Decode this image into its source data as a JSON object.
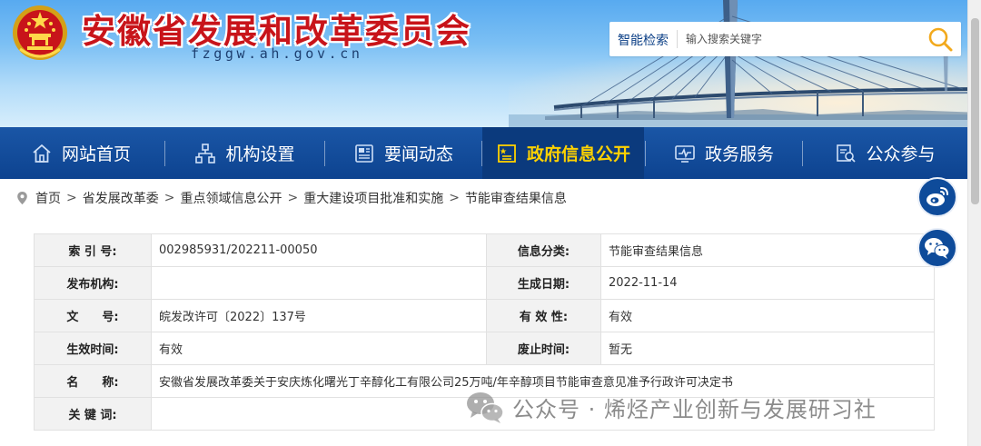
{
  "header": {
    "site_title": "安徽省发展和改革委员会",
    "site_domain": "fzggw.ah.gov.cn",
    "emblem_icon": "national-emblem-icon"
  },
  "search": {
    "label": "智能检索",
    "placeholder": "输入搜索关键字",
    "button_icon": "search-icon"
  },
  "nav": {
    "items": [
      {
        "label": "网站首页",
        "icon": "home-icon"
      },
      {
        "label": "机构设置",
        "icon": "org-chart-icon"
      },
      {
        "label": "要闻动态",
        "icon": "news-icon"
      },
      {
        "label": "政府信息公开",
        "icon": "info-disclosure-icon"
      },
      {
        "label": "政务服务",
        "icon": "service-icon"
      },
      {
        "label": "公众参与",
        "icon": "participation-icon"
      }
    ],
    "active_index": 3
  },
  "breadcrumb": {
    "icon": "location-pin-icon",
    "separator": ">",
    "items": [
      "首页",
      "省发展改革委",
      "重点领域信息公开",
      "重大建设项目批准和实施",
      "节能审查结果信息"
    ]
  },
  "info": {
    "index_label": "索 引 号:",
    "index_value": "002985931/202211-00050",
    "category_label": "信息分类:",
    "category_value": "节能审查结果信息",
    "publisher_label": "发布机构:",
    "publisher_value": "",
    "date_label": "生成日期:",
    "date_value": "2022-11-14",
    "doc_label": "文　　号:",
    "doc_value": "皖发改许可〔2022〕137号",
    "validity_label": "有 效 性:",
    "validity_value": "有效",
    "effective_label": "生效时间:",
    "effective_value": "有效",
    "repeal_label": "废止时间:",
    "repeal_value": "暂无",
    "name_label": "名　　称:",
    "name_value": "安徽省发展改革委关于安庆炼化曙光丁辛醇化工有限公司25万吨/年辛醇项目节能审查意见准予行政许可决定书",
    "keywords_label": "关 键 词:",
    "keywords_value": ""
  },
  "side": {
    "weibo_icon": "weibo-icon",
    "wechat_icon": "wechat-icon"
  },
  "watermark": {
    "text": "公众号 · 烯烃产业创新与发展研习社",
    "icon": "wechat-logo-icon"
  },
  "colors": {
    "nav_bg": "#1a56a6",
    "nav_active_text": "#ffd200",
    "title_red": "#c8141a"
  }
}
